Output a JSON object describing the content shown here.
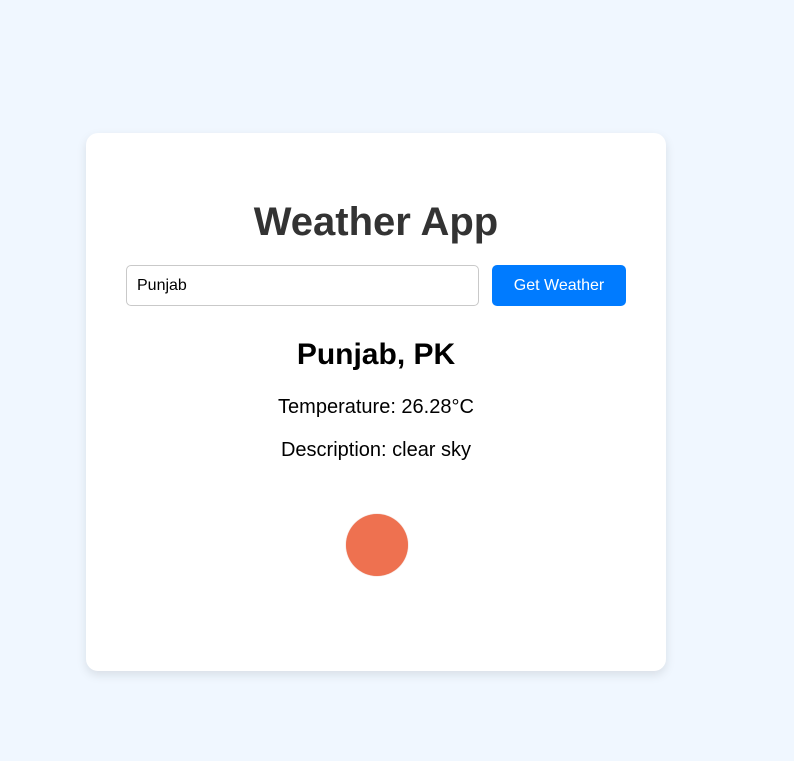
{
  "app": {
    "title": "Weather App"
  },
  "search": {
    "value": "Punjab",
    "button_label": "Get Weather"
  },
  "result": {
    "location": "Punjab, PK",
    "temperature": "Temperature: 26.28°C",
    "description": "Description: clear sky",
    "icon": "sun-icon"
  },
  "colors": {
    "background": "#f0f7ff",
    "accent": "#007bff",
    "sun": "#ee7150"
  }
}
